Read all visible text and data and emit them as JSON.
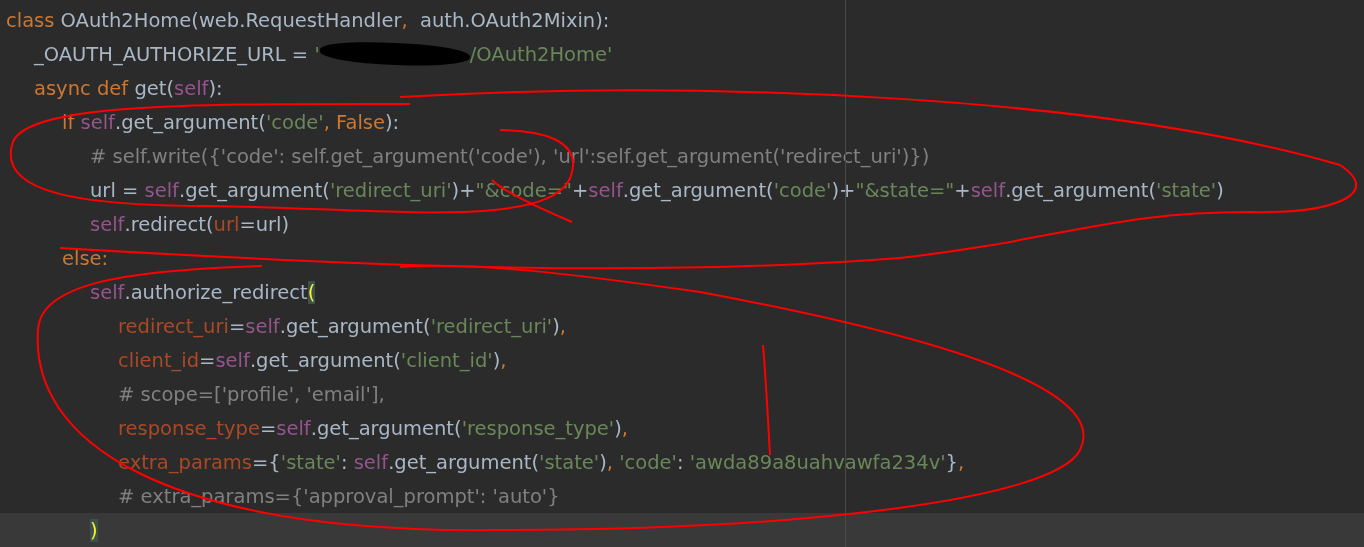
{
  "editor": {
    "lines": [
      {
        "current": false,
        "tokens": [
          {
            "kind": "keyword",
            "text": "class "
          },
          {
            "kind": "plain",
            "text": "OAuth2Home(web.RequestHandler"
          },
          {
            "kind": "keyword",
            "text": ","
          },
          {
            "kind": "plain",
            "text": "  auth.OAuth2Mixin):"
          }
        ],
        "children": [
          {
            "current": false,
            "tokens": [
              {
                "kind": "plain",
                "text": "_OAUTH_AUTHORIZE_URL = "
              },
              {
                "kind": "string",
                "text": "'"
              },
              {
                "kind": "redacted"
              },
              {
                "kind": "string",
                "text": "/OAuth2Home'"
              }
            ]
          },
          {
            "current": false,
            "tokens": [
              {
                "kind": "keyword",
                "text": "async def "
              },
              {
                "kind": "plain",
                "text": "get("
              },
              {
                "kind": "self",
                "text": "self"
              },
              {
                "kind": "plain",
                "text": "):"
              }
            ],
            "children": [
              {
                "current": false,
                "tokens": [
                  {
                    "kind": "keyword",
                    "text": "if "
                  },
                  {
                    "kind": "self",
                    "text": "self"
                  },
                  {
                    "kind": "plain",
                    "text": ".get_argument("
                  },
                  {
                    "kind": "string",
                    "text": "'code'"
                  },
                  {
                    "kind": "keyword",
                    "text": ", False"
                  },
                  {
                    "kind": "plain",
                    "text": "):"
                  }
                ],
                "children": [
                  {
                    "current": false,
                    "tokens": [
                      {
                        "kind": "comment",
                        "text": "# self.write({'code': self.get_argument('code'), 'url':self.get_argument('redirect_uri')})"
                      }
                    ]
                  },
                  {
                    "current": false,
                    "tokens": [
                      {
                        "kind": "plain",
                        "text": "url = "
                      },
                      {
                        "kind": "self",
                        "text": "self"
                      },
                      {
                        "kind": "plain",
                        "text": ".get_argument("
                      },
                      {
                        "kind": "string",
                        "text": "'redirect_uri'"
                      },
                      {
                        "kind": "plain",
                        "text": ")+"
                      },
                      {
                        "kind": "string",
                        "text": "\"&code=\""
                      },
                      {
                        "kind": "plain",
                        "text": "+"
                      },
                      {
                        "kind": "self",
                        "text": "self"
                      },
                      {
                        "kind": "plain",
                        "text": ".get_argument("
                      },
                      {
                        "kind": "string",
                        "text": "'code'"
                      },
                      {
                        "kind": "plain",
                        "text": ")+"
                      },
                      {
                        "kind": "string",
                        "text": "\"&state=\""
                      },
                      {
                        "kind": "plain",
                        "text": "+"
                      },
                      {
                        "kind": "self",
                        "text": "self"
                      },
                      {
                        "kind": "plain",
                        "text": ".get_argument("
                      },
                      {
                        "kind": "string",
                        "text": "'state'"
                      },
                      {
                        "kind": "plain",
                        "text": ")"
                      }
                    ]
                  },
                  {
                    "current": false,
                    "tokens": [
                      {
                        "kind": "self",
                        "text": "self"
                      },
                      {
                        "kind": "plain",
                        "text": ".redirect("
                      },
                      {
                        "kind": "param",
                        "text": "url"
                      },
                      {
                        "kind": "plain",
                        "text": "=url)"
                      }
                    ]
                  }
                ]
              },
              {
                "current": false,
                "tokens": [
                  {
                    "kind": "keyword",
                    "text": "else:"
                  }
                ],
                "children": [
                  {
                    "current": false,
                    "tokens": [
                      {
                        "kind": "self",
                        "text": "self"
                      },
                      {
                        "kind": "plain",
                        "text": ".authorize_redirect"
                      },
                      {
                        "kind": "brace",
                        "text": "("
                      }
                    ],
                    "children": [
                      {
                        "current": false,
                        "tokens": [
                          {
                            "kind": "param",
                            "text": "redirect_uri"
                          },
                          {
                            "kind": "plain",
                            "text": "="
                          },
                          {
                            "kind": "self",
                            "text": "self"
                          },
                          {
                            "kind": "plain",
                            "text": ".get_argument("
                          },
                          {
                            "kind": "string",
                            "text": "'redirect_uri'"
                          },
                          {
                            "kind": "plain",
                            "text": ")"
                          },
                          {
                            "kind": "keyword",
                            "text": ","
                          }
                        ]
                      },
                      {
                        "current": false,
                        "tokens": [
                          {
                            "kind": "param",
                            "text": "client_id"
                          },
                          {
                            "kind": "plain",
                            "text": "="
                          },
                          {
                            "kind": "self",
                            "text": "self"
                          },
                          {
                            "kind": "plain",
                            "text": ".get_argument("
                          },
                          {
                            "kind": "string",
                            "text": "'client_id'"
                          },
                          {
                            "kind": "plain",
                            "text": ")"
                          },
                          {
                            "kind": "keyword",
                            "text": ","
                          }
                        ]
                      },
                      {
                        "current": false,
                        "tokens": [
                          {
                            "kind": "comment",
                            "text": "# scope=['profile', 'email'],"
                          }
                        ]
                      },
                      {
                        "current": false,
                        "tokens": [
                          {
                            "kind": "param",
                            "text": "response_type"
                          },
                          {
                            "kind": "plain",
                            "text": "="
                          },
                          {
                            "kind": "self",
                            "text": "self"
                          },
                          {
                            "kind": "plain",
                            "text": ".get_argument("
                          },
                          {
                            "kind": "string",
                            "text": "'response_type'"
                          },
                          {
                            "kind": "plain",
                            "text": ")"
                          },
                          {
                            "kind": "keyword",
                            "text": ","
                          }
                        ]
                      },
                      {
                        "current": false,
                        "tokens": [
                          {
                            "kind": "param",
                            "text": "extra_params"
                          },
                          {
                            "kind": "plain",
                            "text": "={"
                          },
                          {
                            "kind": "string",
                            "text": "'state'"
                          },
                          {
                            "kind": "plain",
                            "text": ": "
                          },
                          {
                            "kind": "self",
                            "text": "self"
                          },
                          {
                            "kind": "plain",
                            "text": ".get_argument("
                          },
                          {
                            "kind": "string",
                            "text": "'state'"
                          },
                          {
                            "kind": "plain",
                            "text": ")"
                          },
                          {
                            "kind": "keyword",
                            "text": ", "
                          },
                          {
                            "kind": "string",
                            "text": "'code'"
                          },
                          {
                            "kind": "plain",
                            "text": ": "
                          },
                          {
                            "kind": "string",
                            "text": "'awda89a8uahvawfa234v'"
                          },
                          {
                            "kind": "plain",
                            "text": "}"
                          },
                          {
                            "kind": "keyword",
                            "text": ","
                          }
                        ]
                      },
                      {
                        "current": false,
                        "tokens": [
                          {
                            "kind": "comment",
                            "text": "# extra_params={'approval_prompt': 'auto'}"
                          }
                        ]
                      }
                    ]
                  },
                  {
                    "current": true,
                    "tokens": [
                      {
                        "kind": "brace",
                        "text": ")"
                      }
                    ]
                  }
                ]
              }
            ]
          }
        ]
      }
    ]
  }
}
